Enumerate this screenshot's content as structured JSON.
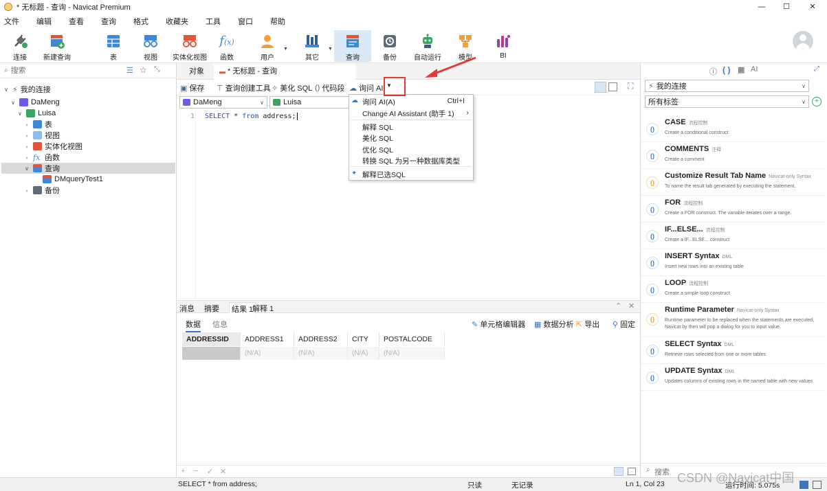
{
  "window": {
    "title": "* 无标题 - 查询 - Navicat Premium",
    "controls": [
      "—",
      "☐",
      "✕"
    ]
  },
  "menu": [
    "文件",
    "编辑",
    "查看",
    "查询",
    "格式",
    "收藏夹",
    "工具",
    "窗口",
    "帮助"
  ],
  "toolbar": {
    "connect": "连接",
    "new_query": "新建查询",
    "table": "表",
    "view": "视图",
    "mview": "实体化视图",
    "function": "函数",
    "user": "用户",
    "other": "其它",
    "query": "查询",
    "backup": "备份",
    "automation": "自动运行",
    "model": "模型",
    "bi": "BI"
  },
  "left": {
    "search_placeholder": "搜索",
    "tree": {
      "root": "我的连接",
      "connection": "DaMeng",
      "schema": "Luisa",
      "nodes": [
        "表",
        "视图",
        "实体化视图",
        "函数",
        "查询"
      ],
      "query_item": "DMqueryTest1",
      "backup": "备份"
    }
  },
  "tabs": {
    "objects": "对象",
    "current": "* 无标题 - 查询"
  },
  "query_toolbar": {
    "save": "保存",
    "builder": "查询创建工具",
    "beautify": "美化 SQL",
    "snippet": "代码段",
    "ask_ai": "询问 AI"
  },
  "selectors": {
    "connection": "DaMeng",
    "schema": "Luisa"
  },
  "editor": {
    "line_number": "1",
    "keyword_select": "SELECT",
    "star": "*",
    "keyword_from": "from",
    "rest": "address;"
  },
  "ai_menu": {
    "ask_ai": "询问 AI(A)",
    "ask_ai_shortcut": "Ctrl+I",
    "change_assistant": "Change AI Assistant (助手 1)",
    "explain": "解释 SQL",
    "beautify": "美化 SQL",
    "optimize": "优化 SQL",
    "convert": "转换 SQL 为另一种数据库类型",
    "explain_selected": "解释已选SQL"
  },
  "results": {
    "tabs": [
      "消息",
      "摘要",
      "结果 1",
      "解释 1"
    ],
    "subtabs": [
      "数据",
      "信息"
    ],
    "actions": {
      "cell_editor": "单元格编辑器",
      "analysis": "数据分析",
      "export": "导出",
      "pin": "固定"
    },
    "columns": [
      "ADDRESSID",
      "ADDRESS1",
      "ADDRESS2",
      "CITY",
      "POSTALCODE"
    ],
    "row": [
      "",
      "(N/A)",
      "(N/A)",
      "(N/A)",
      "(N/A)"
    ],
    "footer": [
      "+",
      "−",
      "✓",
      "✕"
    ]
  },
  "right": {
    "connection": "我的连接",
    "tags": "所有标签",
    "search": "搜索",
    "snippets": [
      {
        "title": "CASE",
        "tag": "流程控制",
        "desc": "Create a conditional construct"
      },
      {
        "title": "COMMENTS",
        "tag": "注释",
        "desc": "Create a comment"
      },
      {
        "title": "Customize Result Tab Name",
        "tag": "Navicat-only Syntax",
        "desc": "To name the result tab generated by executing the statement."
      },
      {
        "title": "FOR",
        "tag": "流程控制",
        "desc": "Create a FOR construct. The variable iterates over a range."
      },
      {
        "title": "IF...ELSE...",
        "tag": "流程控制",
        "desc": "Create a IF...ELSE... construct"
      },
      {
        "title": "INSERT Syntax",
        "tag": "DML",
        "desc": "Insert new rows into an existing table"
      },
      {
        "title": "LOOP",
        "tag": "流程控制",
        "desc": "Create a simple loop construct"
      },
      {
        "title": "Runtime Parameter",
        "tag": "Navicat-only Syntax",
        "desc": "Runtime parameter to be replaced when the statements are executed, Navicat by then will pop a dialog for you to input value."
      },
      {
        "title": "SELECT Syntax",
        "tag": "DML",
        "desc": "Retrieve rows selected from one or more tables"
      },
      {
        "title": "UPDATE Syntax",
        "tag": "DML",
        "desc": "Updates columns of existing rows in the named table with new values"
      }
    ]
  },
  "status": {
    "sql": "SELECT * from address;",
    "readonly": "只读",
    "records": "无记录",
    "position": "Ln 1, Col 23",
    "runtime": "运行时间: 5.075s"
  },
  "watermark": "CSDN @Navicat中国",
  "colors": {
    "accent": "#3a76c4",
    "highlight_red": "#e53935",
    "keyword": "#2a52be"
  }
}
